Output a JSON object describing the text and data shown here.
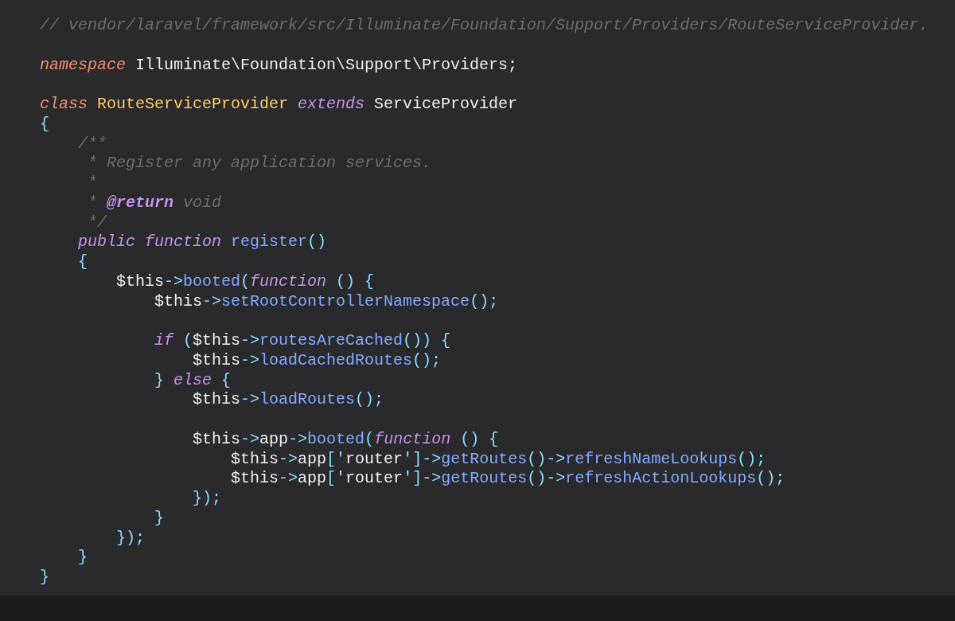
{
  "code_lines": [
    {
      "kind": "code",
      "tokens": [
        {
          "text": "// vendor/laravel/framework/src/Illuminate/Foundation/Support/Providers/RouteServiceProvider.",
          "kind": "comment"
        }
      ]
    },
    {
      "kind": "blank"
    },
    {
      "kind": "code",
      "tokens": [
        {
          "text": "namespace",
          "kind": "keyword"
        },
        {
          "text": " Illuminate\\Foundation\\Support\\Providers;",
          "kind": "plain"
        }
      ]
    },
    {
      "kind": "blank"
    },
    {
      "kind": "code",
      "tokens": [
        {
          "text": "class",
          "kind": "keyword"
        },
        {
          "text": " RouteServiceProvider",
          "kind": "classname"
        },
        {
          "text": " extends",
          "kind": "storage"
        },
        {
          "text": " ServiceProvider",
          "kind": "plain"
        }
      ]
    },
    {
      "kind": "code",
      "tokens": [
        {
          "text": "{",
          "kind": "punct"
        }
      ]
    },
    {
      "kind": "code",
      "tokens": [
        {
          "text": "    /**",
          "kind": "comment"
        }
      ]
    },
    {
      "kind": "code",
      "tokens": [
        {
          "text": "     * Register any application services.",
          "kind": "comment"
        }
      ]
    },
    {
      "kind": "code",
      "tokens": [
        {
          "text": "     *",
          "kind": "comment"
        }
      ]
    },
    {
      "kind": "code",
      "tokens": [
        {
          "text": "     * ",
          "kind": "comment"
        },
        {
          "text": "@return",
          "kind": "doctag"
        },
        {
          "text": " void",
          "kind": "comment"
        }
      ]
    },
    {
      "kind": "code",
      "tokens": [
        {
          "text": "     */",
          "kind": "comment"
        }
      ]
    },
    {
      "kind": "code",
      "tokens": [
        {
          "text": "    public function ",
          "kind": "storage"
        },
        {
          "text": "register",
          "kind": "func"
        },
        {
          "text": "()",
          "kind": "punct"
        }
      ]
    },
    {
      "kind": "code",
      "tokens": [
        {
          "text": "    {",
          "kind": "punct"
        }
      ]
    },
    {
      "kind": "code",
      "tokens": [
        {
          "text": "        $this",
          "kind": "plain"
        },
        {
          "text": "->",
          "kind": "punct"
        },
        {
          "text": "booted",
          "kind": "func"
        },
        {
          "text": "(",
          "kind": "punct"
        },
        {
          "text": "function",
          "kind": "storage"
        },
        {
          "text": " () {",
          "kind": "punct"
        }
      ]
    },
    {
      "kind": "code",
      "tokens": [
        {
          "text": "            $this",
          "kind": "plain"
        },
        {
          "text": "->",
          "kind": "punct"
        },
        {
          "text": "setRootControllerNamespace",
          "kind": "func"
        },
        {
          "text": "();",
          "kind": "punct"
        }
      ]
    },
    {
      "kind": "blank"
    },
    {
      "kind": "code",
      "tokens": [
        {
          "text": "            if",
          "kind": "storage"
        },
        {
          "text": " (",
          "kind": "punct"
        },
        {
          "text": "$this",
          "kind": "plain"
        },
        {
          "text": "->",
          "kind": "punct"
        },
        {
          "text": "routesAreCached",
          "kind": "func"
        },
        {
          "text": "()) {",
          "kind": "punct"
        }
      ]
    },
    {
      "kind": "code",
      "tokens": [
        {
          "text": "                $this",
          "kind": "plain"
        },
        {
          "text": "->",
          "kind": "punct"
        },
        {
          "text": "loadCachedRoutes",
          "kind": "func"
        },
        {
          "text": "();",
          "kind": "punct"
        }
      ]
    },
    {
      "kind": "code",
      "tokens": [
        {
          "text": "            } ",
          "kind": "punct"
        },
        {
          "text": "else",
          "kind": "storage"
        },
        {
          "text": " {",
          "kind": "punct"
        }
      ]
    },
    {
      "kind": "code",
      "tokens": [
        {
          "text": "                $this",
          "kind": "plain"
        },
        {
          "text": "->",
          "kind": "punct"
        },
        {
          "text": "loadRoutes",
          "kind": "func"
        },
        {
          "text": "();",
          "kind": "punct"
        }
      ]
    },
    {
      "kind": "blank"
    },
    {
      "kind": "code",
      "tokens": [
        {
          "text": "                $this",
          "kind": "plain"
        },
        {
          "text": "->",
          "kind": "punct"
        },
        {
          "text": "app",
          "kind": "plain"
        },
        {
          "text": "->",
          "kind": "punct"
        },
        {
          "text": "booted",
          "kind": "func"
        },
        {
          "text": "(",
          "kind": "punct"
        },
        {
          "text": "function",
          "kind": "storage"
        },
        {
          "text": " () {",
          "kind": "punct"
        }
      ]
    },
    {
      "kind": "code",
      "tokens": [
        {
          "text": "                    $this",
          "kind": "plain"
        },
        {
          "text": "->",
          "kind": "punct"
        },
        {
          "text": "app",
          "kind": "plain"
        },
        {
          "text": "['",
          "kind": "punct"
        },
        {
          "text": "router",
          "kind": "plain"
        },
        {
          "text": "']->",
          "kind": "punct"
        },
        {
          "text": "getRoutes",
          "kind": "func"
        },
        {
          "text": "()->",
          "kind": "punct"
        },
        {
          "text": "refreshNameLookups",
          "kind": "func"
        },
        {
          "text": "();",
          "kind": "punct"
        }
      ]
    },
    {
      "kind": "code",
      "tokens": [
        {
          "text": "                    $this",
          "kind": "plain"
        },
        {
          "text": "->",
          "kind": "punct"
        },
        {
          "text": "app",
          "kind": "plain"
        },
        {
          "text": "['",
          "kind": "punct"
        },
        {
          "text": "router",
          "kind": "plain"
        },
        {
          "text": "']->",
          "kind": "punct"
        },
        {
          "text": "getRoutes",
          "kind": "func"
        },
        {
          "text": "()->",
          "kind": "punct"
        },
        {
          "text": "refreshActionLookups",
          "kind": "func"
        },
        {
          "text": "();",
          "kind": "punct"
        }
      ]
    },
    {
      "kind": "code",
      "tokens": [
        {
          "text": "                });",
          "kind": "punct"
        }
      ]
    },
    {
      "kind": "code",
      "tokens": [
        {
          "text": "            }",
          "kind": "punct"
        }
      ]
    },
    {
      "kind": "code",
      "tokens": [
        {
          "text": "        });",
          "kind": "punct"
        }
      ]
    },
    {
      "kind": "code",
      "tokens": [
        {
          "text": "    }",
          "kind": "punct"
        }
      ]
    },
    {
      "kind": "code",
      "tokens": [
        {
          "text": "}",
          "kind": "punct"
        }
      ]
    }
  ]
}
